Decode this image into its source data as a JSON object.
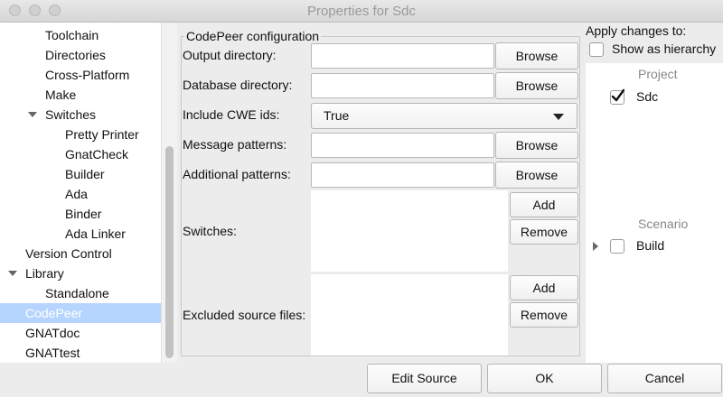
{
  "window": {
    "title": "Properties for Sdc"
  },
  "tree": {
    "items": [
      {
        "label": "Toolchain"
      },
      {
        "label": "Directories"
      },
      {
        "label": "Cross-Platform"
      },
      {
        "label": "Make"
      },
      {
        "label": "Switches"
      },
      {
        "label": "Pretty Printer"
      },
      {
        "label": "GnatCheck"
      },
      {
        "label": "Builder"
      },
      {
        "label": "Ada"
      },
      {
        "label": "Binder"
      },
      {
        "label": "Ada Linker"
      },
      {
        "label": "Version Control"
      },
      {
        "label": "Library"
      },
      {
        "label": "Standalone"
      },
      {
        "label": "CodePeer"
      },
      {
        "label": "GNATdoc"
      },
      {
        "label": "GNATtest"
      }
    ]
  },
  "codepeer": {
    "group_title": "CodePeer configuration",
    "output_directory": {
      "label": "Output directory:",
      "value": "",
      "browse": "Browse"
    },
    "database_directory": {
      "label": "Database directory:",
      "value": "",
      "browse": "Browse"
    },
    "include_cwe": {
      "label": "Include CWE ids:",
      "selected": "True"
    },
    "message_patterns": {
      "label": "Message patterns:",
      "value": "",
      "browse": "Browse"
    },
    "additional_patterns": {
      "label": "Additional patterns:",
      "value": "",
      "browse": "Browse"
    },
    "switches": {
      "label": "Switches:",
      "add": "Add",
      "remove": "Remove"
    },
    "excluded": {
      "label": "Excluded source files:",
      "add": "Add",
      "remove": "Remove"
    }
  },
  "apply": {
    "title": "Apply changes to:",
    "show_hierarchy": {
      "label": "Show as hierarchy",
      "checked": false
    },
    "project_header": "Project",
    "project_item": {
      "label": "Sdc",
      "checked": true
    },
    "scenario_header": "Scenario",
    "scenario_item": {
      "label": "Build",
      "checked": false
    }
  },
  "footer": {
    "edit_source": "Edit Source",
    "ok": "OK",
    "cancel": "Cancel"
  }
}
